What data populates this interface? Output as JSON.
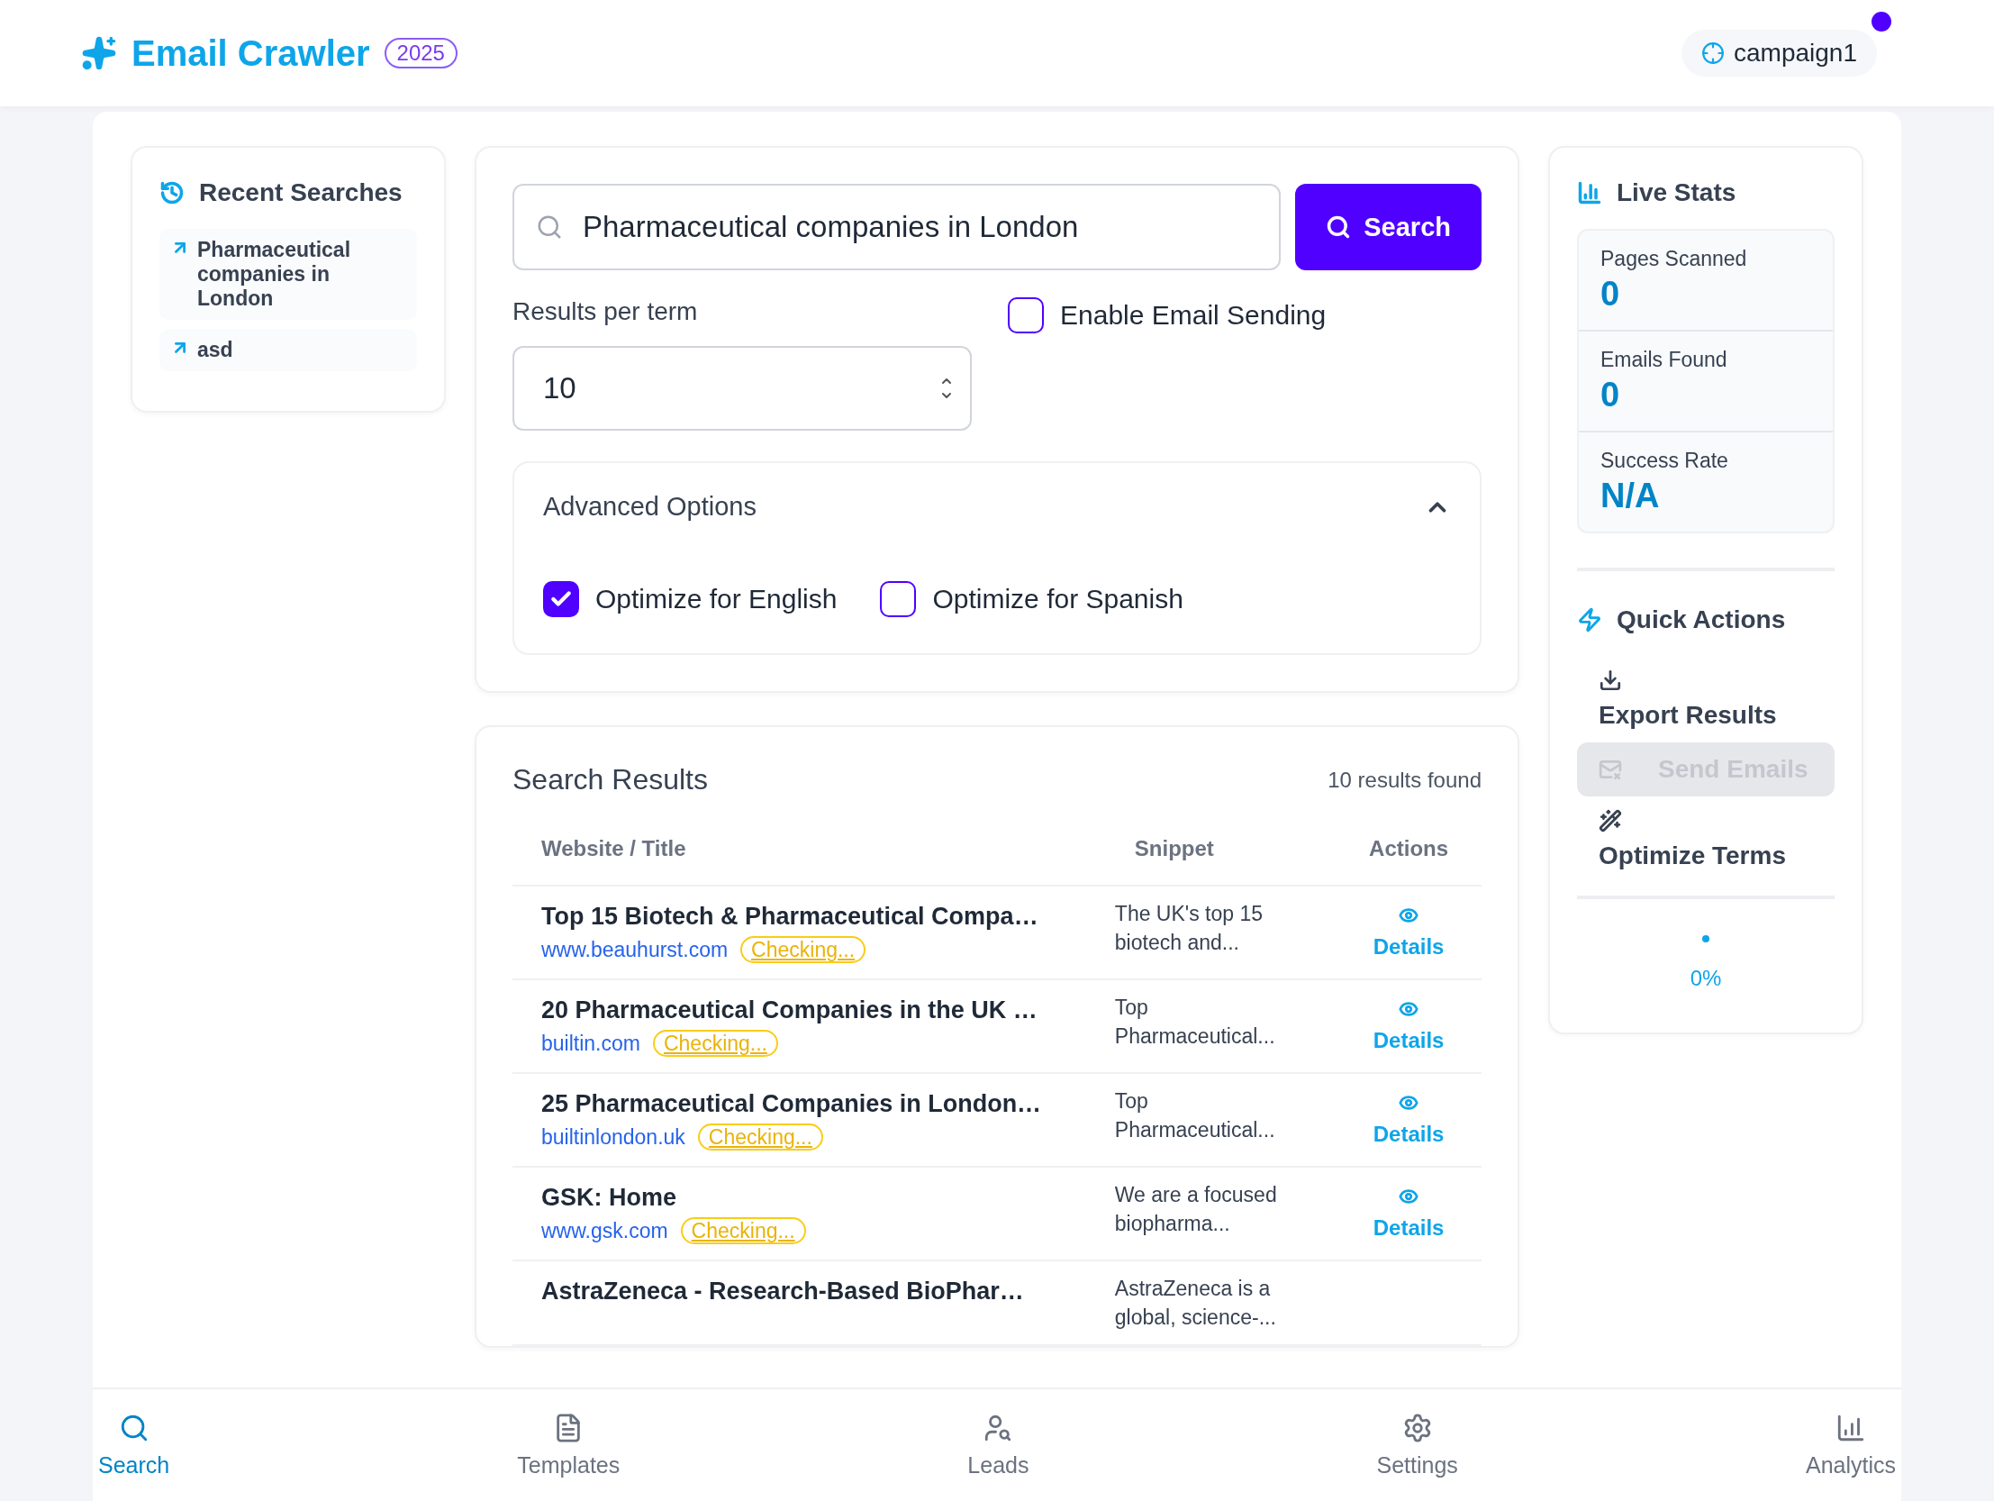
{
  "header": {
    "title": "Email Crawler",
    "badge": "2025",
    "campaign": {
      "label": "campaign1",
      "notification": true
    }
  },
  "recent_searches": {
    "title": "Recent Searches",
    "items": [
      {
        "label": "Pharmaceutical companies in London"
      },
      {
        "label": "asd"
      }
    ]
  },
  "search": {
    "value": "Pharmaceutical companies in London",
    "button": "Search"
  },
  "results_per_term": {
    "label": "Results per term",
    "value": "10"
  },
  "email_sending": {
    "label": "Enable Email Sending",
    "checked": false
  },
  "advanced": {
    "title": "Advanced Options",
    "expanded": true,
    "options": [
      {
        "label": "Optimize for English",
        "checked": true
      },
      {
        "label": "Optimize for Spanish",
        "checked": false
      }
    ]
  },
  "results": {
    "title": "Search Results",
    "count": "10 results found",
    "columns": [
      "Website / Title",
      "Snippet",
      "Actions"
    ],
    "rows": [
      {
        "title": "Top 15 Biotech & Pharmaceutical Compa…",
        "url": "www.beauhurst.com",
        "status": "Checking...",
        "snippet": "The UK's top 15 biotech and...",
        "action": "Details"
      },
      {
        "title": "20 Pharmaceutical Companies in the UK …",
        "url": "builtin.com",
        "status": "Checking...",
        "snippet": "Top Pharmaceutical...",
        "action": "Details"
      },
      {
        "title": "25 Pharmaceutical Companies in London…",
        "url": "builtinlondon.uk",
        "status": "Checking...",
        "snippet": "Top Pharmaceutical...",
        "action": "Details"
      },
      {
        "title": "GSK: Home",
        "url": "www.gsk.com",
        "status": "Checking...",
        "snippet": "We are a focused biopharma...",
        "action": "Details"
      },
      {
        "title": "AstraZeneca - Research-Based BioPhar…",
        "snippet": "AstraZeneca is a global, science-..."
      }
    ]
  },
  "live_stats": {
    "title": "Live Stats",
    "stats": [
      {
        "label": "Pages Scanned",
        "value": "0"
      },
      {
        "label": "Emails Found",
        "value": "0"
      },
      {
        "label": "Success Rate",
        "value": "N/A"
      }
    ]
  },
  "quick_actions": {
    "title": "Quick Actions",
    "actions": [
      {
        "kind": "export",
        "label": "Export Results",
        "disabled": false
      },
      {
        "kind": "send",
        "label": "Send Emails",
        "disabled": true
      },
      {
        "kind": "optimize",
        "label": "Optimize Terms",
        "disabled": false
      }
    ]
  },
  "progress": {
    "label": "0%"
  },
  "bottom_nav": [
    {
      "kind": "search",
      "label": "Search",
      "selected": true
    },
    {
      "kind": "templates",
      "label": "Templates",
      "selected": false
    },
    {
      "kind": "leads",
      "label": "Leads",
      "selected": false
    },
    {
      "kind": "settings",
      "label": "Settings",
      "selected": false
    },
    {
      "kind": "analytics",
      "label": "Analytics",
      "selected": false
    }
  ]
}
